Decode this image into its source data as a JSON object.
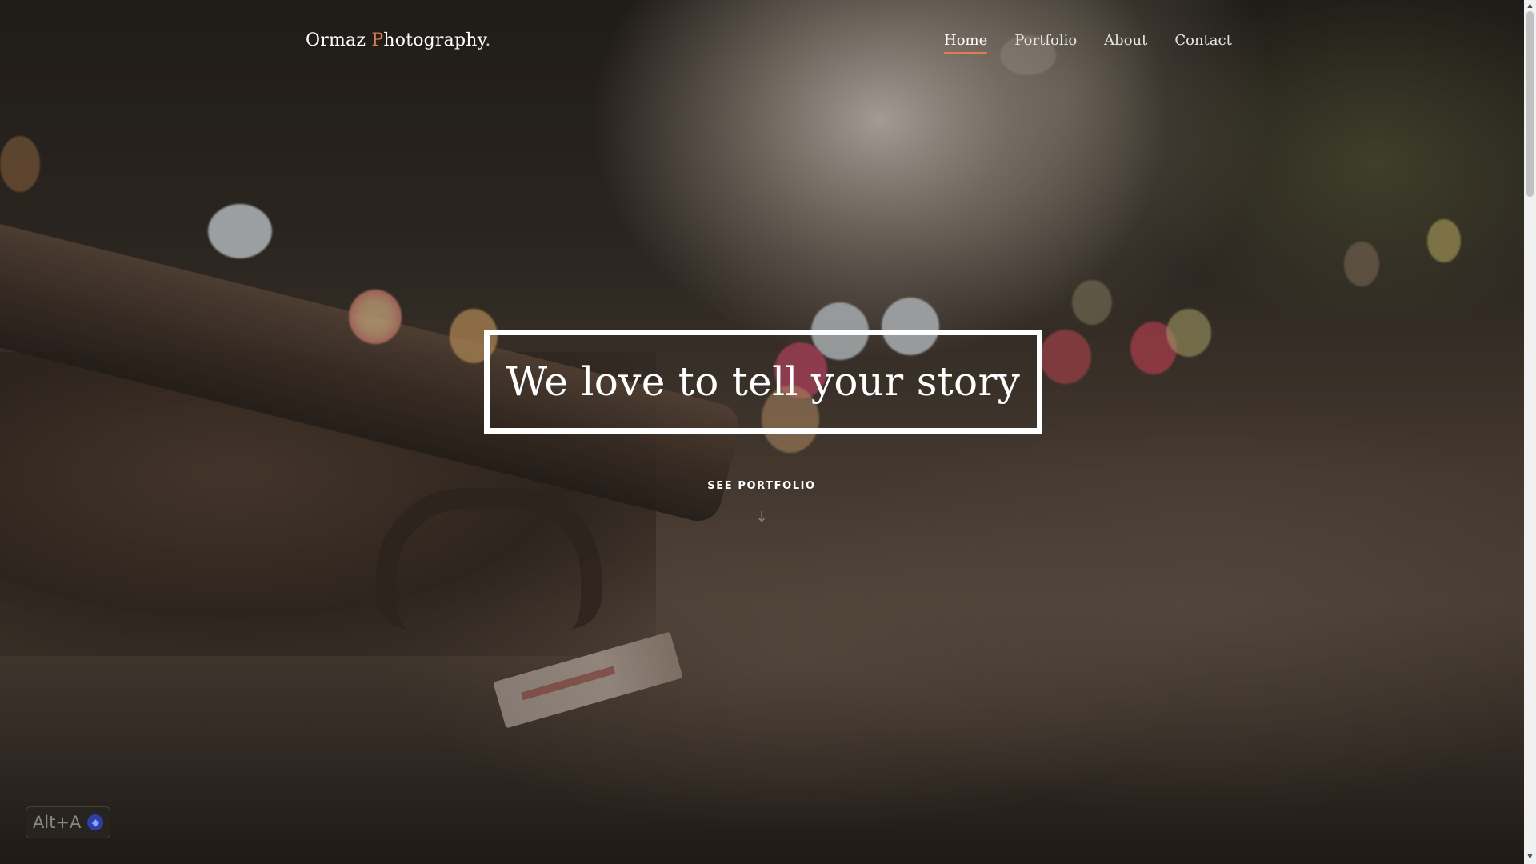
{
  "brand": {
    "part1": "Ormaz ",
    "accent_letter": "P",
    "part2": "hotography",
    "dot": "."
  },
  "nav": {
    "items": [
      {
        "label": "Home",
        "active": true
      },
      {
        "label": "Portfolio",
        "active": false
      },
      {
        "label": "About",
        "active": false
      },
      {
        "label": "Contact",
        "active": false
      }
    ]
  },
  "hero": {
    "title": "We love to tell your story",
    "cta_label": "SEE PORTFOLIO",
    "cta_arrow": "↓"
  },
  "badge": {
    "shortcut": "Alt+A"
  },
  "colors": {
    "accent": "#e07b5a",
    "text": "#ffffff"
  },
  "icons": {
    "arrow": "arrow-down-icon",
    "badge": "assistant-icon"
  }
}
